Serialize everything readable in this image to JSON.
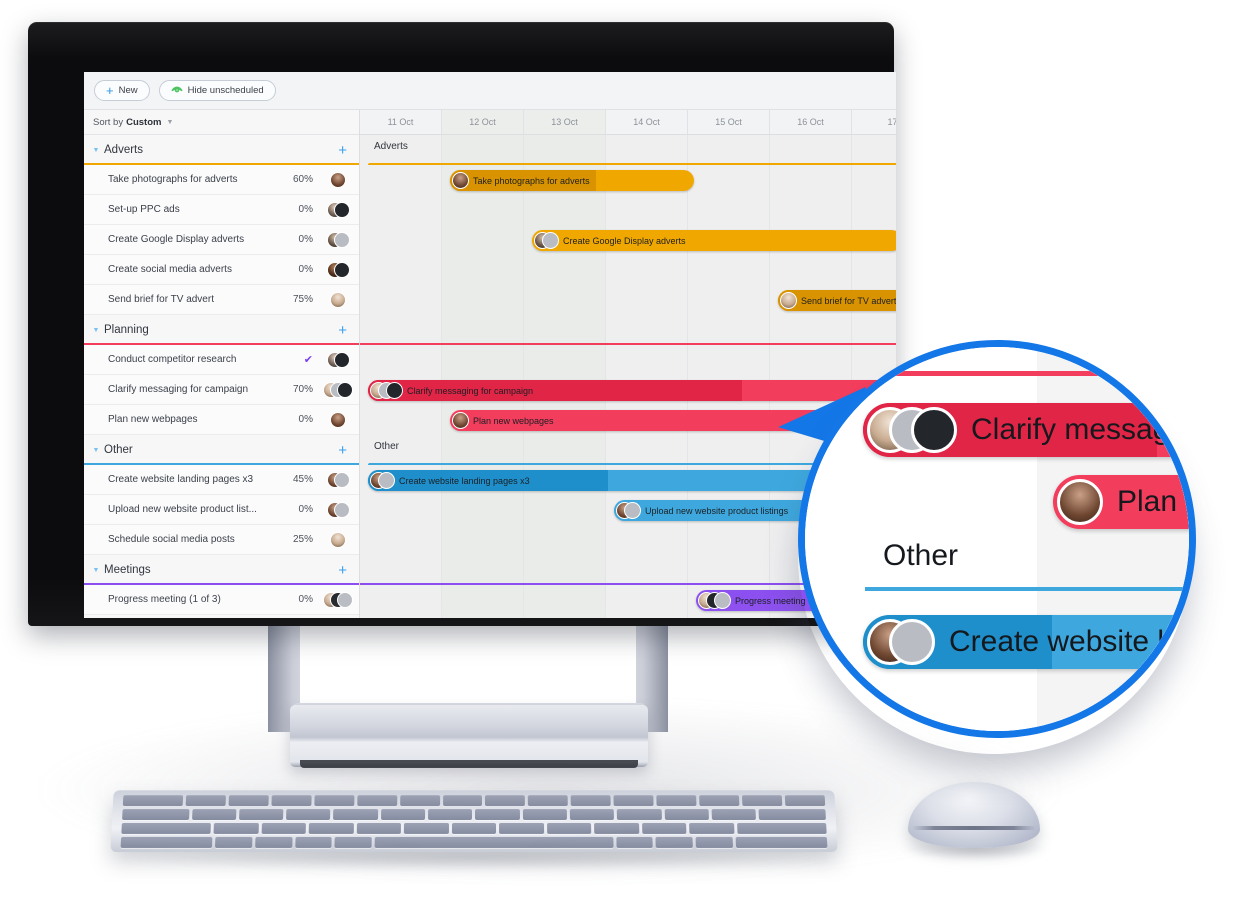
{
  "app": {
    "toolbar": {
      "new_label": "New",
      "hide_unscheduled_label": "Hide unscheduled",
      "new_icon": "plus-icon",
      "hide_icon": "eye-icon"
    },
    "sidebar": {
      "sort_prefix": "Sort by",
      "sort_value": "Custom",
      "add_icon": "plus-icon",
      "collapse_icon": "caret-down-icon"
    },
    "timeline": {
      "dates": [
        "11 Oct",
        "12 Oct",
        "13 Oct",
        "14 Oct",
        "15 Oct",
        "16 Oct",
        "17"
      ],
      "weekend_indices": [
        1,
        2
      ]
    },
    "colors": {
      "adverts": "#F0A800",
      "adverts_progress": "#D99300",
      "planning": "#F23D5C",
      "planning_progress": "#E02546",
      "other": "#3EA8DE",
      "other_progress": "#1E8FCB",
      "meetings": "#8B4DF0",
      "accent_blue": "#2F97E8",
      "magnifier_ring": "#1477E8",
      "check": "#7A3FF0"
    },
    "groups": [
      {
        "name": "Adverts",
        "color": "#F0A800",
        "tasks": [
          {
            "name": "Take photographs for adverts",
            "progress": "60%",
            "avatars": [
              "a1"
            ]
          },
          {
            "name": "Set-up PPC ads",
            "progress": "0%",
            "avatars": [
              "a2",
              "dark"
            ]
          },
          {
            "name": "Create Google Display adverts",
            "progress": "0%",
            "avatars": [
              "a3",
              "gray"
            ]
          },
          {
            "name": "Create social media adverts",
            "progress": "0%",
            "avatars": [
              "a4",
              "dark"
            ]
          },
          {
            "name": "Send brief for TV advert",
            "progress": "75%",
            "avatars": [
              "a5"
            ]
          }
        ]
      },
      {
        "name": "Planning",
        "color": "#F23D5C",
        "tasks": [
          {
            "name": "Conduct competitor research",
            "progress": "✔",
            "done": true,
            "avatars": [
              "a2",
              "dark"
            ]
          },
          {
            "name": "Clarify messaging for campaign",
            "progress": "70%",
            "avatars": [
              "a5",
              "gray",
              "dark"
            ]
          },
          {
            "name": "Plan new webpages",
            "progress": "0%",
            "avatars": [
              "a1"
            ]
          }
        ]
      },
      {
        "name": "Other",
        "color": "#3EA8DE",
        "tasks": [
          {
            "name": "Create website landing pages x3",
            "progress": "45%",
            "avatars": [
              "a1",
              "gray"
            ]
          },
          {
            "name": "Upload new website product list...",
            "progress": "0%",
            "avatars": [
              "a1",
              "gray"
            ]
          },
          {
            "name": "Schedule social media posts",
            "progress": "25%",
            "avatars": [
              "a5"
            ]
          }
        ]
      },
      {
        "name": "Meetings",
        "color": "#8B4DF0",
        "tasks": [
          {
            "name": "Progress meeting (1 of 3)",
            "progress": "0%",
            "avatars": [
              "a5",
              "dark",
              "gray"
            ]
          }
        ]
      }
    ],
    "bars": [
      {
        "label": "Take photographs for adverts",
        "group": "Adverts"
      },
      {
        "label": "Create Google Display adverts",
        "group": "Adverts"
      },
      {
        "label": "Send brief for TV advert",
        "group": "Adverts"
      },
      {
        "label": "Clarify messaging for campaign",
        "group": "Planning"
      },
      {
        "label": "Plan new webpages",
        "group": "Planning"
      },
      {
        "label": "Create website landing pages x3",
        "group": "Other"
      },
      {
        "label": "Upload new website product listings",
        "group": "Other"
      },
      {
        "label": "Progress meeting",
        "group": "Meetings"
      }
    ],
    "gantt_group_labels": [
      "Adverts",
      "Other"
    ]
  },
  "magnifier": {
    "bars": [
      {
        "label": "Clarify messaging for c",
        "color": "#F23D5C"
      },
      {
        "label": "Plan new",
        "color": "#F23D5C"
      },
      {
        "label": "Create website landing",
        "color": "#3EA8DE"
      }
    ],
    "group_label": "Other"
  }
}
